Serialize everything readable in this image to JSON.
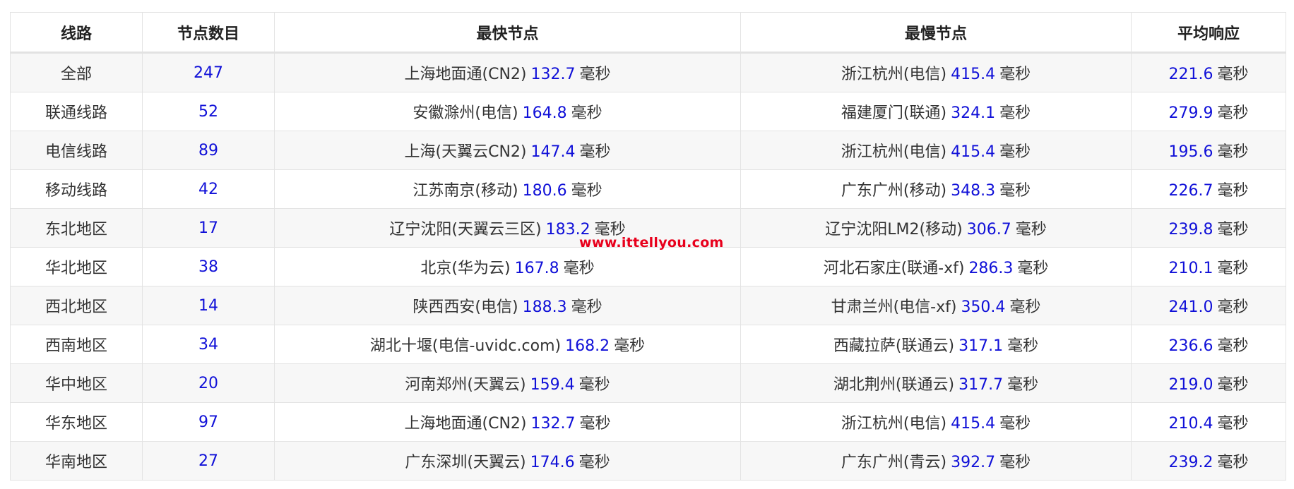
{
  "headers": [
    "线路",
    "节点数目",
    "最快节点",
    "最慢节点",
    "平均响应"
  ],
  "unit": "毫秒",
  "rows": [
    {
      "route": "全部",
      "count": "247",
      "fastest_name": "上海地面通(CN2)",
      "fastest_ms": "132.7",
      "slowest_name": "浙江杭州(电信)",
      "slowest_ms": "415.4",
      "avg_ms": "221.6"
    },
    {
      "route": "联通线路",
      "count": "52",
      "fastest_name": "安徽滁州(电信)",
      "fastest_ms": "164.8",
      "slowest_name": "福建厦门(联通)",
      "slowest_ms": "324.1",
      "avg_ms": "279.9"
    },
    {
      "route": "电信线路",
      "count": "89",
      "fastest_name": "上海(天翼云CN2)",
      "fastest_ms": "147.4",
      "slowest_name": "浙江杭州(电信)",
      "slowest_ms": "415.4",
      "avg_ms": "195.6"
    },
    {
      "route": "移动线路",
      "count": "42",
      "fastest_name": "江苏南京(移动)",
      "fastest_ms": "180.6",
      "slowest_name": "广东广州(移动)",
      "slowest_ms": "348.3",
      "avg_ms": "226.7"
    },
    {
      "route": "东北地区",
      "count": "17",
      "fastest_name": "辽宁沈阳(天翼云三区)",
      "fastest_ms": "183.2",
      "slowest_name": "辽宁沈阳LM2(移动)",
      "slowest_ms": "306.7",
      "avg_ms": "239.8"
    },
    {
      "route": "华北地区",
      "count": "38",
      "fastest_name": "北京(华为云)",
      "fastest_ms": "167.8",
      "slowest_name": "河北石家庄(联通-xf)",
      "slowest_ms": "286.3",
      "avg_ms": "210.1"
    },
    {
      "route": "西北地区",
      "count": "14",
      "fastest_name": "陕西西安(电信)",
      "fastest_ms": "188.3",
      "slowest_name": "甘肃兰州(电信-xf)",
      "slowest_ms": "350.4",
      "avg_ms": "241.0"
    },
    {
      "route": "西南地区",
      "count": "34",
      "fastest_name": "湖北十堰(电信-uvidc.com)",
      "fastest_ms": "168.2",
      "slowest_name": "西藏拉萨(联通云)",
      "slowest_ms": "317.1",
      "avg_ms": "236.6"
    },
    {
      "route": "华中地区",
      "count": "20",
      "fastest_name": "河南郑州(天翼云)",
      "fastest_ms": "159.4",
      "slowest_name": "湖北荆州(联通云)",
      "slowest_ms": "317.7",
      "avg_ms": "219.0"
    },
    {
      "route": "华东地区",
      "count": "97",
      "fastest_name": "上海地面通(CN2)",
      "fastest_ms": "132.7",
      "slowest_name": "浙江杭州(电信)",
      "slowest_ms": "415.4",
      "avg_ms": "210.4"
    },
    {
      "route": "华南地区",
      "count": "27",
      "fastest_name": "广东深圳(天翼云)",
      "fastest_ms": "174.6",
      "slowest_name": "广东广州(青云)",
      "slowest_ms": "392.7",
      "avg_ms": "239.2"
    }
  ],
  "watermark": "www.ittellyou.com",
  "colors": {
    "number": "#1010d8",
    "watermark": "#e8001c",
    "row_stripe": "#f7f7f7",
    "border": "#e3e3e3"
  }
}
